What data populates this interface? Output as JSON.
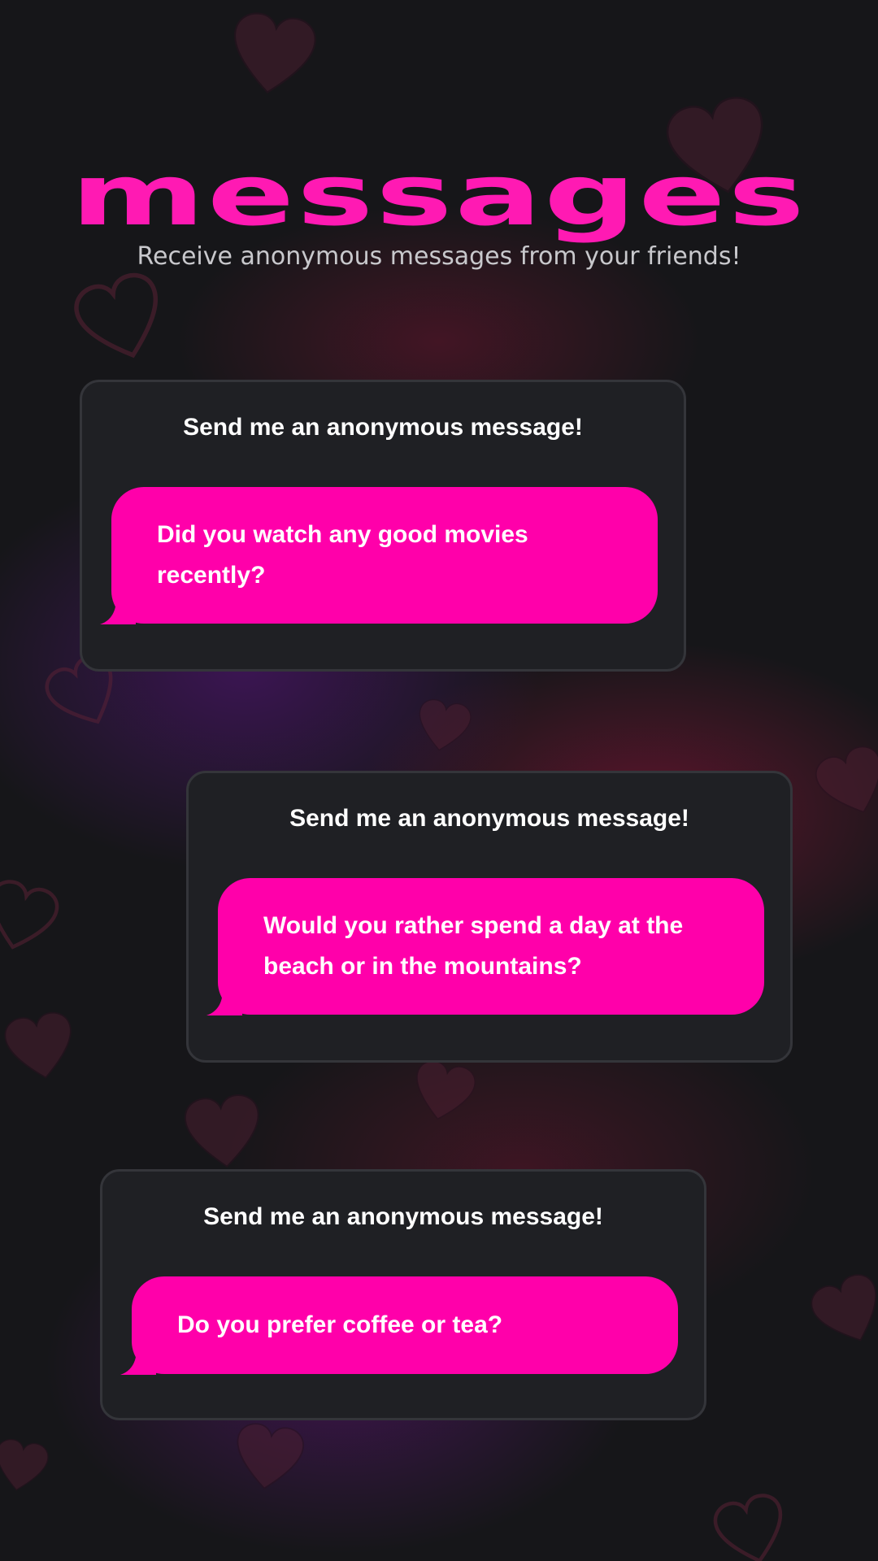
{
  "header": {
    "title": "messages",
    "subtitle": "Receive anonymous messages from your friends!"
  },
  "cards": [
    {
      "header": "Send me an anonymous message!",
      "message": "Did you watch any good movies recently?"
    },
    {
      "header": "Send me an anonymous message!",
      "message": "Would you rather spend a day at the beach or in the mountains?"
    },
    {
      "header": "Send me an anonymous message!",
      "message": "Do you prefer coffee or tea?"
    }
  ],
  "colors": {
    "background": "#161619",
    "accent": "#ff1ab3",
    "bubble": "#ff00aa",
    "card": "#1f2024",
    "card_border": "#34353a",
    "subtitle": "#c8c8cc"
  },
  "icons": [
    "heart-icon"
  ]
}
